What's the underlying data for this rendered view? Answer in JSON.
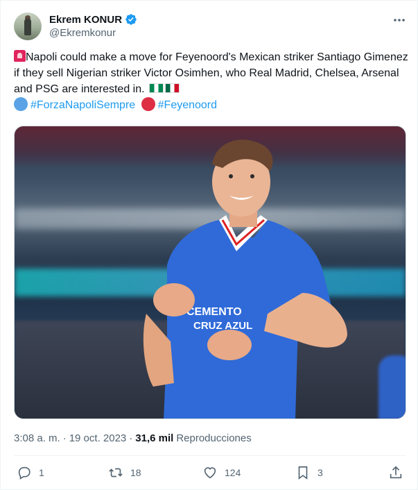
{
  "author": {
    "display_name": "Ekrem KONUR",
    "handle": "@Ekremkonur"
  },
  "tweet": {
    "text_line1": "Napoli could make a move for Feyenoord's Mexican striker Santiago Gimenez if they sell Nigerian striker Victor Osimhen, who Real Madrid, Chelsea, Arsenal and PSG are interested in.",
    "hashtag1": "#ForzaNapoliSempre",
    "hashtag2": "#Feyenoord"
  },
  "meta": {
    "time": "3:08 a. m.",
    "separator": "·",
    "date": "19 oct. 2023",
    "separator2": "·",
    "views_count": "31,6 mil",
    "views_label": "Reproducciones"
  },
  "actions": {
    "reply_count": "1",
    "retweet_count": "18",
    "like_count": "124",
    "bookmark_count": "3"
  },
  "colors": {
    "accent": "#1d9bf0",
    "muted": "#536471",
    "text": "#0f1419"
  },
  "icons": {
    "verified": "verified-badge-icon",
    "more": "more-dots-icon",
    "reply": "reply-icon",
    "retweet": "retweet-icon",
    "like": "heart-icon",
    "bookmark": "bookmark-icon",
    "share": "share-icon"
  }
}
